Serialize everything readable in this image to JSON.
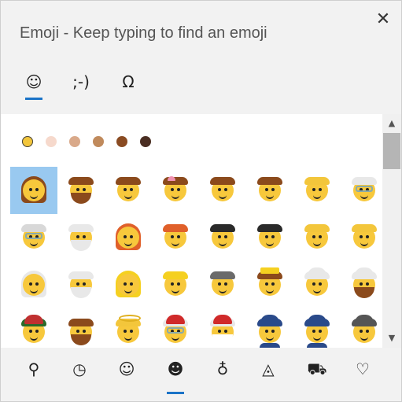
{
  "window": {
    "title": "Emoji - Keep typing to find an emoji",
    "close_glyph": "✕"
  },
  "mode_tabs": [
    {
      "name": "emoji",
      "glyph": "☺",
      "active": true
    },
    {
      "name": "kaomoji",
      "glyph": ";-)",
      "active": false
    },
    {
      "name": "symbols",
      "glyph": "Ω",
      "active": false
    }
  ],
  "skin_tones": [
    {
      "color": "#f3c63b",
      "selected": true
    },
    {
      "color": "#f6d9cc"
    },
    {
      "color": "#d9a98a"
    },
    {
      "color": "#c08a5c"
    },
    {
      "color": "#8a4b22"
    },
    {
      "color": "#4a2e22"
    }
  ],
  "emoji_rows": [
    [
      {
        "name": "woman",
        "hair": "#8b4a1c",
        "long": true,
        "selected": true
      },
      {
        "name": "man",
        "hair": "#8b4a1c",
        "beard": "#8b4a1c"
      },
      {
        "name": "boy",
        "hair": "#8b4a1c"
      },
      {
        "name": "girl",
        "hair": "#8b4a1c",
        "bow": true
      },
      {
        "name": "person",
        "hair": "#8b4a1c"
      },
      {
        "name": "child",
        "hair": "#8b4a1c"
      },
      {
        "name": "baby",
        "hair": "#f3c63b"
      },
      {
        "name": "old-woman",
        "hair": "#e8e8e8",
        "glasses": true
      }
    ],
    [
      {
        "name": "old-man",
        "hair": "#d8d8d8",
        "glasses": true
      },
      {
        "name": "older-person",
        "hair": "#e8e8e8",
        "beard": "#e8e8e8"
      },
      {
        "name": "woman-red-hair",
        "hair": "#e0602a",
        "long": true
      },
      {
        "name": "man-red-hair",
        "hair": "#e0602a"
      },
      {
        "name": "woman-curly-hair",
        "hair": "#2a2a2a"
      },
      {
        "name": "man-curly-hair",
        "hair": "#2a2a2a"
      },
      {
        "name": "woman-bald",
        "hair": "#f3c63b"
      },
      {
        "name": "man-bald",
        "hair": "#f3c63b"
      }
    ],
    [
      {
        "name": "woman-white-hair",
        "hair": "#e8e8e8",
        "long": true
      },
      {
        "name": "man-white-hair",
        "hair": "#e8e8e8",
        "beard": "#e8e8e8"
      },
      {
        "name": "woman-blond-hair",
        "hair": "#f5d020",
        "long": true
      },
      {
        "name": "man-blond-hair",
        "hair": "#f5d020"
      },
      {
        "name": "woman-health-worker",
        "hair": "#6a6a6a"
      },
      {
        "name": "princess",
        "hair": "#8b4a1c",
        "crown": true
      },
      {
        "name": "person-turban",
        "hair": "#e8e8e8",
        "hat": "#e8e8e8"
      },
      {
        "name": "man-turban",
        "hair": "#e8e8e8",
        "hat": "#e8e8e8",
        "beard": "#8b4a1c"
      }
    ],
    [
      {
        "name": "construction-worker",
        "hair": "#2a6a2a",
        "hat": "#c03030"
      },
      {
        "name": "man-beard",
        "hair": "#8b4a1c",
        "beard": "#8b4a1c"
      },
      {
        "name": "baby-angel",
        "hair": "#f3c63b",
        "halo": true
      },
      {
        "name": "mrs-claus",
        "hair": "#e8e8e8",
        "hat": "#d02a2a",
        "glasses": true
      },
      {
        "name": "santa",
        "hair": "#e8e8e8",
        "hat": "#d02a2a",
        "beard": "#ffffff"
      },
      {
        "name": "woman-police",
        "hair": "#2a4a8a",
        "hat": "#2a4a8a",
        "uniform": true
      },
      {
        "name": "police-officer",
        "hair": "#2a4a8a",
        "hat": "#2a4a8a",
        "uniform": true
      },
      {
        "name": "detective",
        "hair": "#555555",
        "hat": "#555555"
      }
    ]
  ],
  "categories": [
    {
      "name": "search",
      "glyph": "⚲",
      "active": false
    },
    {
      "name": "recent",
      "glyph": "◷",
      "active": false
    },
    {
      "name": "smiley",
      "glyph": "☺",
      "active": false
    },
    {
      "name": "people",
      "glyph": "☻",
      "active": true
    },
    {
      "name": "celebration",
      "glyph": "♁",
      "active": false
    },
    {
      "name": "food",
      "glyph": "◬",
      "active": false
    },
    {
      "name": "transport",
      "glyph": "⛟",
      "active": false
    },
    {
      "name": "heart",
      "glyph": "♡",
      "active": false
    }
  ],
  "scrollbar": {
    "up_glyph": "▲",
    "down_glyph": "▼"
  }
}
